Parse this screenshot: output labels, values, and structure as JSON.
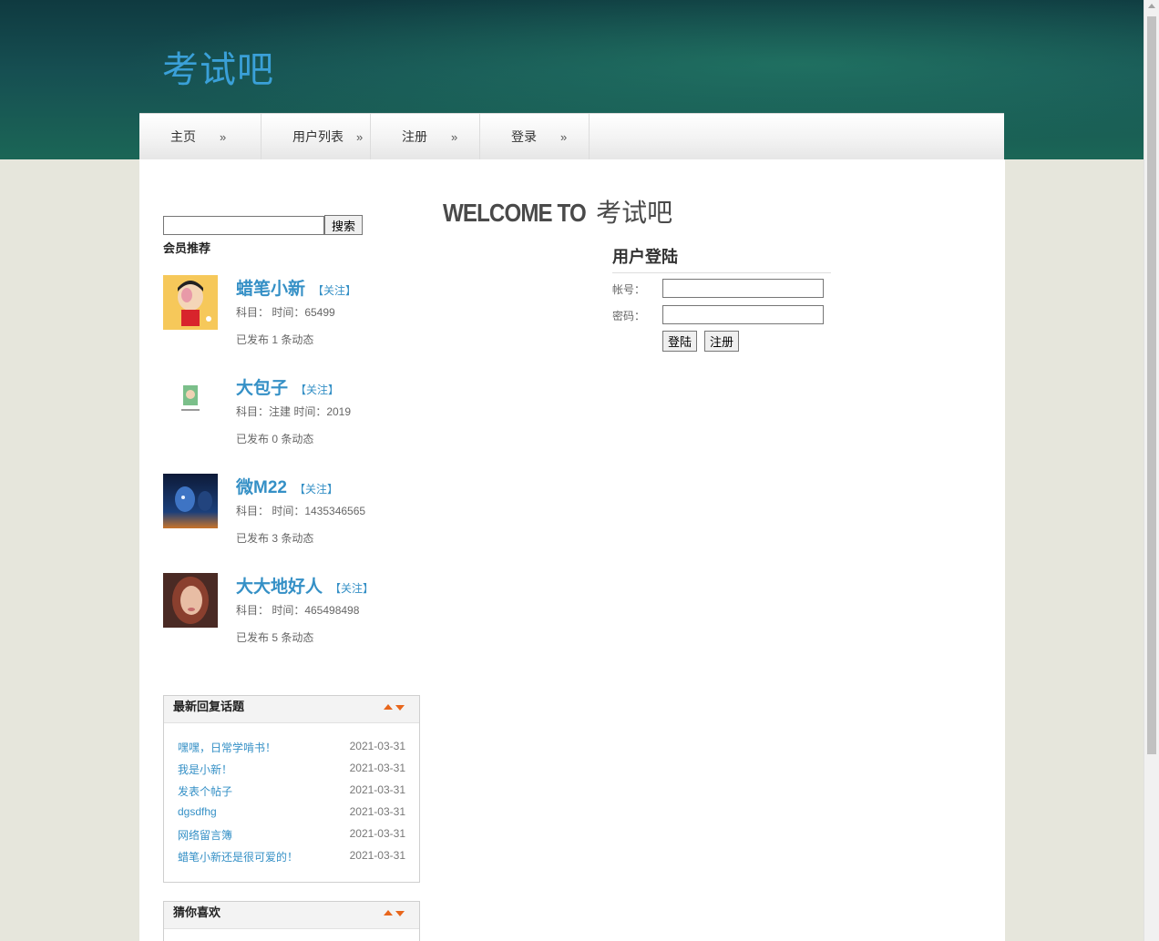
{
  "site": {
    "title": "考试吧"
  },
  "nav": [
    {
      "label": "主页",
      "chevron": "»"
    },
    {
      "label": "用户列表",
      "chevron": "»"
    },
    {
      "label": "注册",
      "chevron": "»"
    },
    {
      "label": "登录",
      "chevron": "»"
    }
  ],
  "welcome": {
    "en": "WELCOME TO",
    "cn": "考试吧"
  },
  "search": {
    "value": "",
    "button": "搜索"
  },
  "members": {
    "heading": "会员推荐",
    "items": [
      {
        "name": "蜡笔小新",
        "follow": "【关注】",
        "sub": "科目： 时间：65499",
        "posts": "已发布 1 条动态",
        "avatar": "avatar-crayon"
      },
      {
        "name": "大包子",
        "follow": "【关注】",
        "sub": "科目：注建 时间：2019",
        "posts": "已发布 0 条动态",
        "avatar": "avatar-small"
      },
      {
        "name": "微M22",
        "follow": "【关注】",
        "sub": "科目： 时间：1435346565",
        "posts": "已发布 3 条动态",
        "avatar": "avatar-blue"
      },
      {
        "name": "大大地好人",
        "follow": "【关注】",
        "sub": "科目： 时间：465498498",
        "posts": "已发布 5 条动态",
        "avatar": "avatar-girl"
      }
    ]
  },
  "login": {
    "title": "用户登陆",
    "username_label": "帐号：",
    "password_label": "密码：",
    "login_button": "登陆",
    "register_button": "注册"
  },
  "latest_topics": {
    "title": "最新回复话题",
    "items": [
      {
        "title": "嘿嘿，日常学啃书！",
        "date": "2021-03-31"
      },
      {
        "title": "我是小新！",
        "date": "2021-03-31"
      },
      {
        "title": "发表个帖子",
        "date": "2021-03-31"
      },
      {
        "title": "dgsdfhg",
        "date": "2021-03-31"
      },
      {
        "title": "网络留言簿",
        "date": "2021-03-31"
      },
      {
        "title": "蜡笔小新还是很可爱的！",
        "date": "2021-03-31"
      }
    ]
  },
  "guess_you_like": {
    "title": "猜你喜欢"
  },
  "colors": {
    "accent": "#3590c6",
    "title": "#3aa0d8",
    "arrow": "#e8661c"
  }
}
